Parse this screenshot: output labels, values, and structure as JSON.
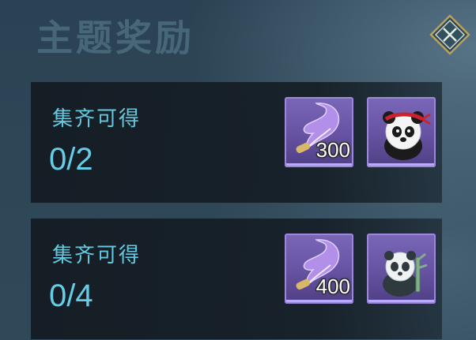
{
  "header": {
    "title": "主题奖励"
  },
  "close_button": {
    "icon": "close-icon"
  },
  "colors": {
    "accent_text": "#62c9e0",
    "slot_purple": "#6a56a6",
    "card_bg": "#161f27"
  },
  "cards": [
    {
      "label": "集齐可得",
      "progress": "0/2",
      "rewards": [
        {
          "icon": "purple-feather-icon",
          "quantity": "300"
        },
        {
          "icon": "panda-red-headband-icon"
        }
      ]
    },
    {
      "label": "集齐可得",
      "progress": "0/4",
      "rewards": [
        {
          "icon": "purple-feather-icon",
          "quantity": "400"
        },
        {
          "icon": "panda-bamboo-icon"
        }
      ]
    }
  ]
}
